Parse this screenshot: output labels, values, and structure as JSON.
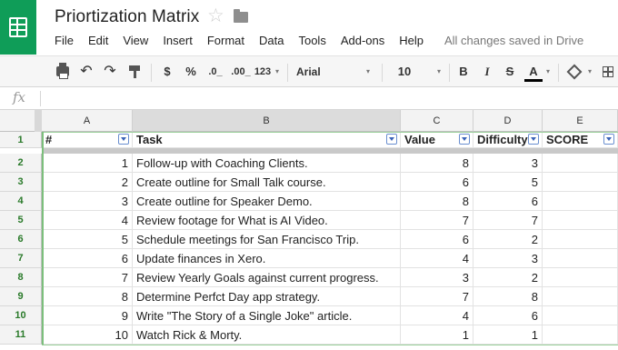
{
  "title": "Priortization Matrix",
  "saved_status": "All changes saved in Drive",
  "menu": [
    "File",
    "Edit",
    "View",
    "Insert",
    "Format",
    "Data",
    "Tools",
    "Add-ons",
    "Help"
  ],
  "toolbar": {
    "currency": "$",
    "percent": "%",
    "dec_less": ".0_",
    "dec_more": ".00_",
    "more_formats": "123",
    "font": "Arial",
    "size": "10",
    "bold": "B",
    "italic": "I",
    "strike": "S",
    "text_color": "A",
    "caret": "▾"
  },
  "formula_bar": {
    "fx": "fx",
    "value": ""
  },
  "columns": [
    "A",
    "B",
    "C",
    "D",
    "E"
  ],
  "header_row": {
    "num": "1",
    "cells": [
      "#",
      "Task",
      "Value",
      "Difficulty",
      "SCORE"
    ]
  },
  "rows": [
    {
      "num": "2",
      "a": "1",
      "task": "Follow-up with Coaching Clients.",
      "value": "8",
      "difficulty": "3",
      "score": ""
    },
    {
      "num": "3",
      "a": "2",
      "task": "Create outline for Small Talk course.",
      "value": "6",
      "difficulty": "5",
      "score": ""
    },
    {
      "num": "4",
      "a": "3",
      "task": "Create outline for Speaker Demo.",
      "value": "8",
      "difficulty": "6",
      "score": ""
    },
    {
      "num": "5",
      "a": "4",
      "task": "Review footage for What is AI Video.",
      "value": "7",
      "difficulty": "7",
      "score": ""
    },
    {
      "num": "6",
      "a": "5",
      "task": "Schedule meetings for San Francisco Trip.",
      "value": "6",
      "difficulty": "2",
      "score": ""
    },
    {
      "num": "7",
      "a": "6",
      "task": "Update finances in Xero.",
      "value": "4",
      "difficulty": "3",
      "score": ""
    },
    {
      "num": "8",
      "a": "7",
      "task": "Review Yearly Goals against current progress.",
      "value": "3",
      "difficulty": "2",
      "score": ""
    },
    {
      "num": "9",
      "a": "8",
      "task": "Determine Perfct Day app strategy.",
      "value": "7",
      "difficulty": "8",
      "score": ""
    },
    {
      "num": "10",
      "a": "9",
      "task": "Write \"The Story of a Single Joke\" article.",
      "value": "4",
      "difficulty": "6",
      "score": ""
    },
    {
      "num": "11",
      "a": "10",
      "task": "Watch Rick & Morty.",
      "value": "1",
      "difficulty": "1",
      "score": ""
    }
  ],
  "colors": {
    "brand": "#0f9d58",
    "row_header_text": "#2a7a2a",
    "selection": "#7cbf7c"
  }
}
